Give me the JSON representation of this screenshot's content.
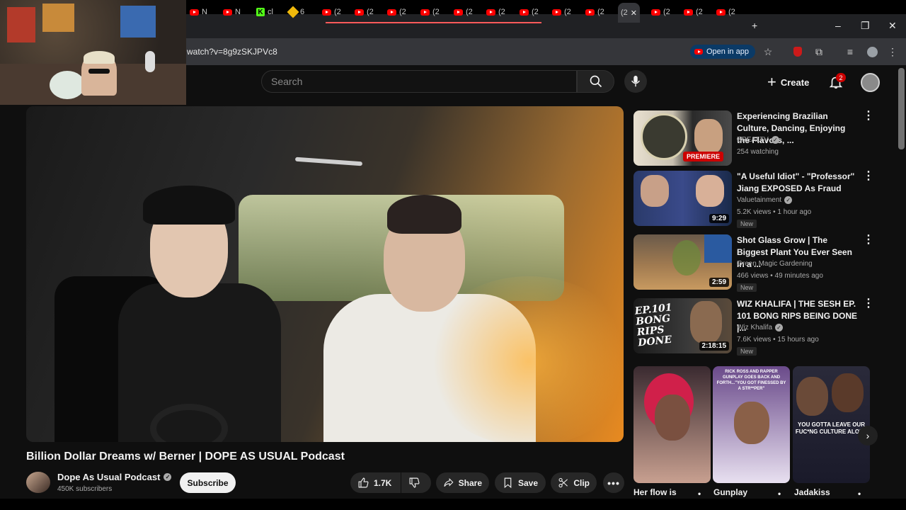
{
  "browser": {
    "tabs": [
      {
        "icon": "youtube-favicon",
        "label": "N"
      },
      {
        "icon": "youtube-favicon",
        "label": "N"
      },
      {
        "icon": "kick-favicon",
        "label": "cl"
      },
      {
        "icon": "binance-favicon",
        "label": "6"
      },
      {
        "icon": "youtube-favicon",
        "label": "(2"
      },
      {
        "icon": "youtube-favicon",
        "label": "(2"
      },
      {
        "icon": "youtube-favicon",
        "label": "(2"
      },
      {
        "icon": "youtube-favicon",
        "label": "(2"
      },
      {
        "icon": "youtube-favicon",
        "label": "(2"
      },
      {
        "icon": "youtube-favicon",
        "label": "(2"
      },
      {
        "icon": "youtube-favicon",
        "label": "(2"
      },
      {
        "icon": "youtube-favicon",
        "label": "(2"
      },
      {
        "icon": "youtube-favicon",
        "label": "(2"
      },
      {
        "icon": "youtube-favicon",
        "label": "(2"
      },
      {
        "icon": "youtube-favicon",
        "label": "(2"
      },
      {
        "icon": "youtube-favicon",
        "label": "(2"
      },
      {
        "icon": "youtube-favicon",
        "label": "(2"
      }
    ],
    "active_tab_label": "(2",
    "url": "watch?v=8g9zSKJPVc8",
    "open_in_app_label": "Open in app"
  },
  "youtube": {
    "search_placeholder": "Search",
    "create_label": "Create",
    "notification_count": "2"
  },
  "video": {
    "title": "Billion Dollar Dreams w/ Berner | DOPE AS USUAL Podcast",
    "channel": "Dope As Usual Podcast",
    "subscribers": "450K subscribers",
    "subscribe_label": "Subscribe",
    "likes": "1.7K",
    "share_label": "Share",
    "save_label": "Save",
    "clip_label": "Clip"
  },
  "recommendations": [
    {
      "title": "Experiencing Brazilian Culture, Dancing, Enjoying the Flavors, ...",
      "channel": "BREALTV",
      "meta": "254 watching",
      "badge": "PREMIERE",
      "duration": "",
      "new": ""
    },
    {
      "title": "\"A Useful Idiot\" - \"Professor\" Jiang EXPOSED As Fraud",
      "channel": "Valuetainment",
      "meta": "5.2K views • 1 hour ago",
      "badge": "",
      "duration": "9:29",
      "new": "New"
    },
    {
      "title": "Shot Glass Grow | The Biggest Plant You Ever Seen In a ...",
      "channel": "Green Magic Gardening",
      "meta": "466 views • 49 minutes ago",
      "badge": "",
      "duration": "2:59",
      "new": "New"
    },
    {
      "title": "WIZ KHALIFA | THE SESH EP. 101 BONG RIPS BEING DONE |...",
      "channel": "Wiz Khalifa",
      "meta": "7.6K views • 15 hours ago",
      "badge": "",
      "duration": "2:18:15",
      "new": "New",
      "thumb_text": "EP.101 BONG RIPS DONE"
    }
  ],
  "shorts": [
    {
      "title": "Her flow is",
      "overlay": ""
    },
    {
      "title": "Gunplay",
      "overlay": "RICK ROSS AND RAPPER GUNPLAY GOES BACK AND FORTH...\"YOU GOT FINESSED BY A STR**PER\""
    },
    {
      "title": "Jadakiss",
      "overlay": "YOU GOTTA LEAVE OUR FUC*NG CULTURE ALONE"
    }
  ],
  "colors": {
    "background": "#0f0f0f",
    "accent_red": "#ff0000",
    "open_in_app_bg": "#0b3a66"
  }
}
